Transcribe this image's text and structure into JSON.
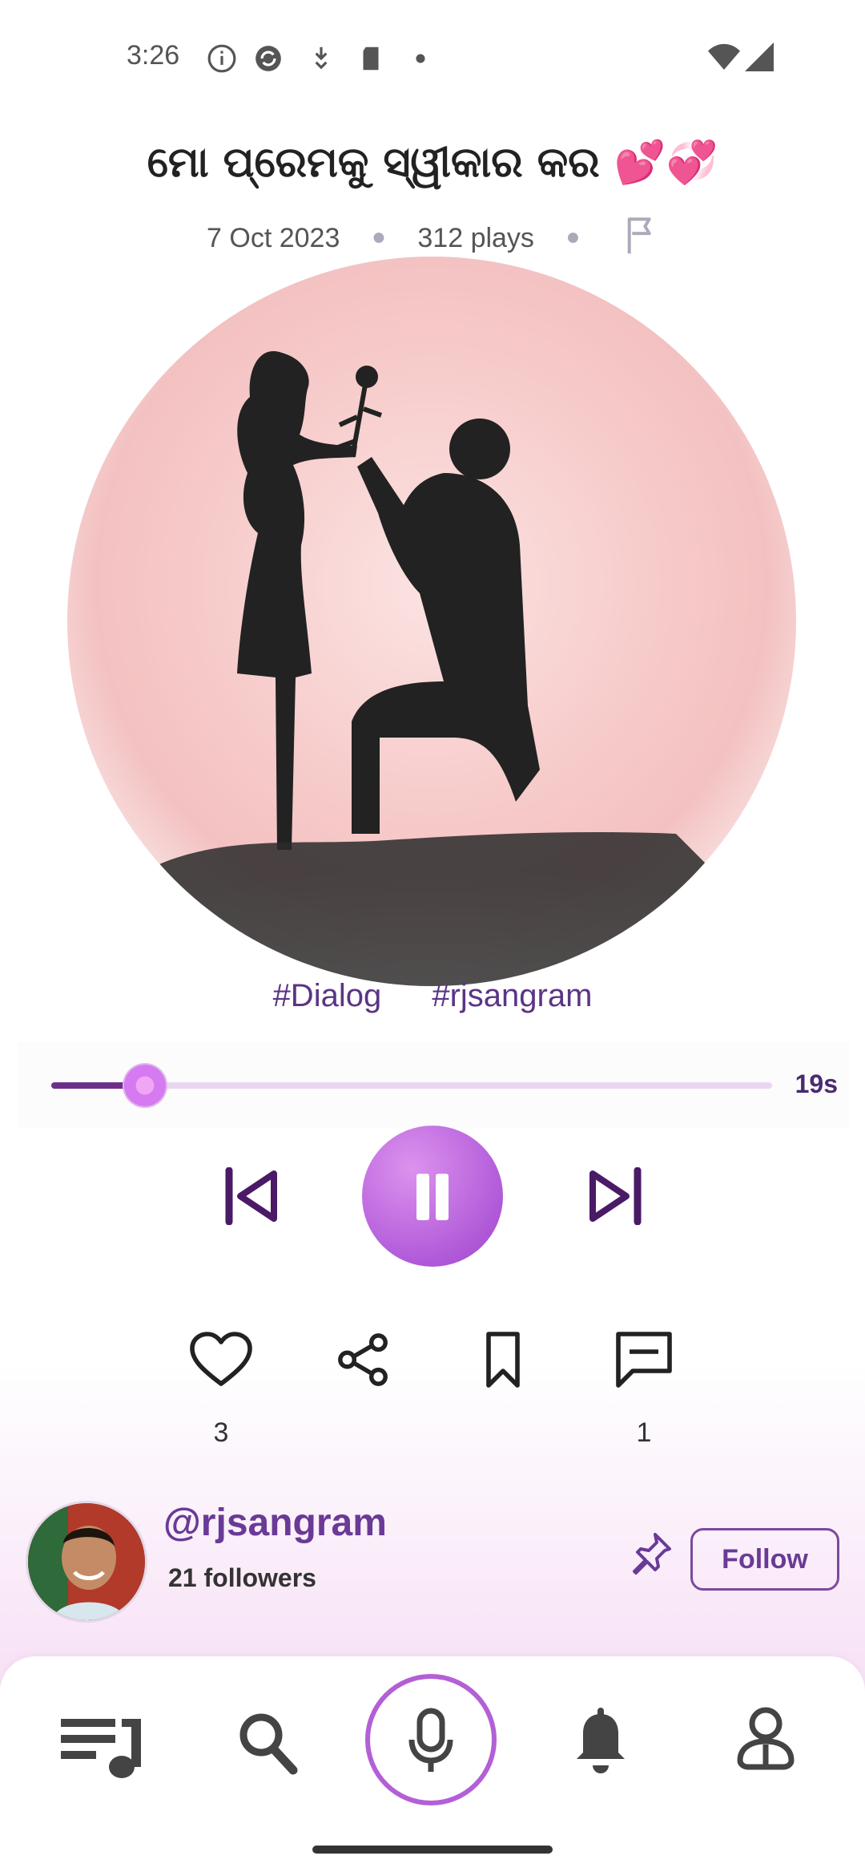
{
  "status_bar": {
    "time": "3:26"
  },
  "track": {
    "title": "ମୋ ପ୍ରେମକୁ ସ୍ୱୀକାର କର 💕💞",
    "date": "7 Oct 2023",
    "plays": "312 plays",
    "tags": [
      "#Dialog",
      "#rjsangram"
    ]
  },
  "player": {
    "time_remaining": "19s",
    "progress_fraction": 0.13
  },
  "actions": {
    "like_count": "3",
    "comment_count": "1"
  },
  "creator": {
    "handle": "@rjsangram",
    "followers": "21 followers",
    "follow_label": "Follow"
  },
  "colors": {
    "accent": "#b35fd6",
    "accent_dark": "#6a3a96",
    "icon_dark": "#4a1a66"
  },
  "nav_icons": [
    "playlist-icon",
    "search-icon",
    "mic-icon",
    "bell-icon",
    "profile-icon"
  ]
}
